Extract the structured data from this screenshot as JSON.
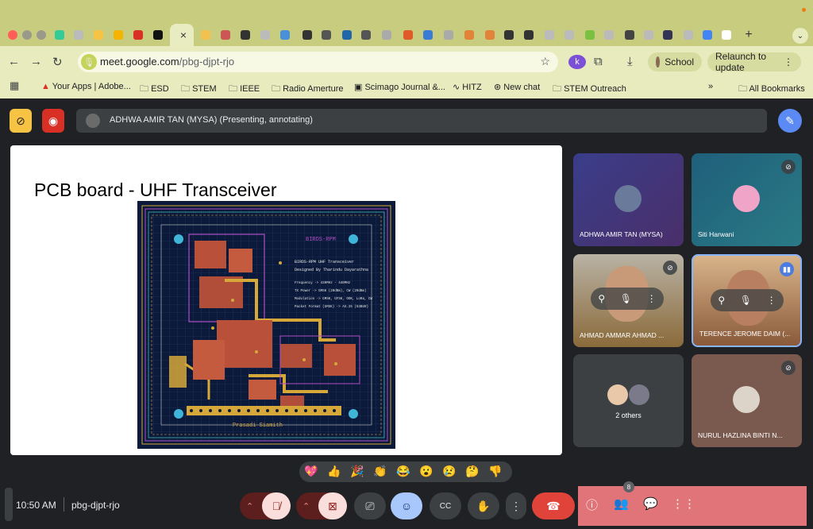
{
  "browser": {
    "new_tab_label": "+",
    "tab_close_label": "×",
    "url_host": "meet.google.com",
    "url_path": "/pbg-djpt-rjo",
    "profile_initial": "k",
    "school_label": "School",
    "relaunch_label": "Relaunch to update",
    "bookmarks": [
      "Your Apps | Adobe...",
      "ESD",
      "STEM",
      "IEEE",
      "Radio Amerture",
      "Scimago Journal &...",
      "HITZ",
      "New chat",
      "STEM Outreach"
    ],
    "all_bookmarks_label": "All Bookmarks",
    "more_bookmarks": "»"
  },
  "meet": {
    "presenter_banner": "ADHWA AMIR TAN (MYSA) (Presenting, annotating)",
    "slide": {
      "title": "PCB board - UHF Transceiver",
      "pcb_text": {
        "name": "BIRDS-RPM",
        "title": "BIRDS-RPM UHF Transceiver",
        "designer": "Designed By Tharindu Dayarathna",
        "freq": "Frequency -> 430MHz - 440MHz",
        "txpower": "TX Power -> GMSK (20dBm), CW (20dBm)",
        "modulation": "Modulation -> GMSK, GFSK, OOK, LoRa, CW",
        "packet": "Packet Format (GMSK) -> AX.25 (53BU9)",
        "footer": "Prasadi  Siamith"
      }
    },
    "participants": [
      {
        "name": "ADHWA AMIR TAN (MYSA)",
        "muted": false
      },
      {
        "name": "Siti Harwani",
        "muted": true
      },
      {
        "name": "AHMAD AMMAR AHMAD ...",
        "muted": true
      },
      {
        "name": "TERENCE JEROME DAIM (...",
        "muted": false
      },
      {
        "name": "2 others",
        "muted": false
      },
      {
        "name": "NURUL HAZLINA BINTI N...",
        "muted": true
      }
    ],
    "reactions": [
      "💖",
      "👍",
      "🎉",
      "👏",
      "😂",
      "😮",
      "😢",
      "🤔",
      "👎"
    ],
    "time": "10:50 AM",
    "meeting_code": "pbg-djpt-rjo",
    "people_count": "8",
    "colors": {
      "leave": "#e0433a",
      "accent_panel": "#e07478",
      "slide_bg": "#ffffff"
    }
  }
}
